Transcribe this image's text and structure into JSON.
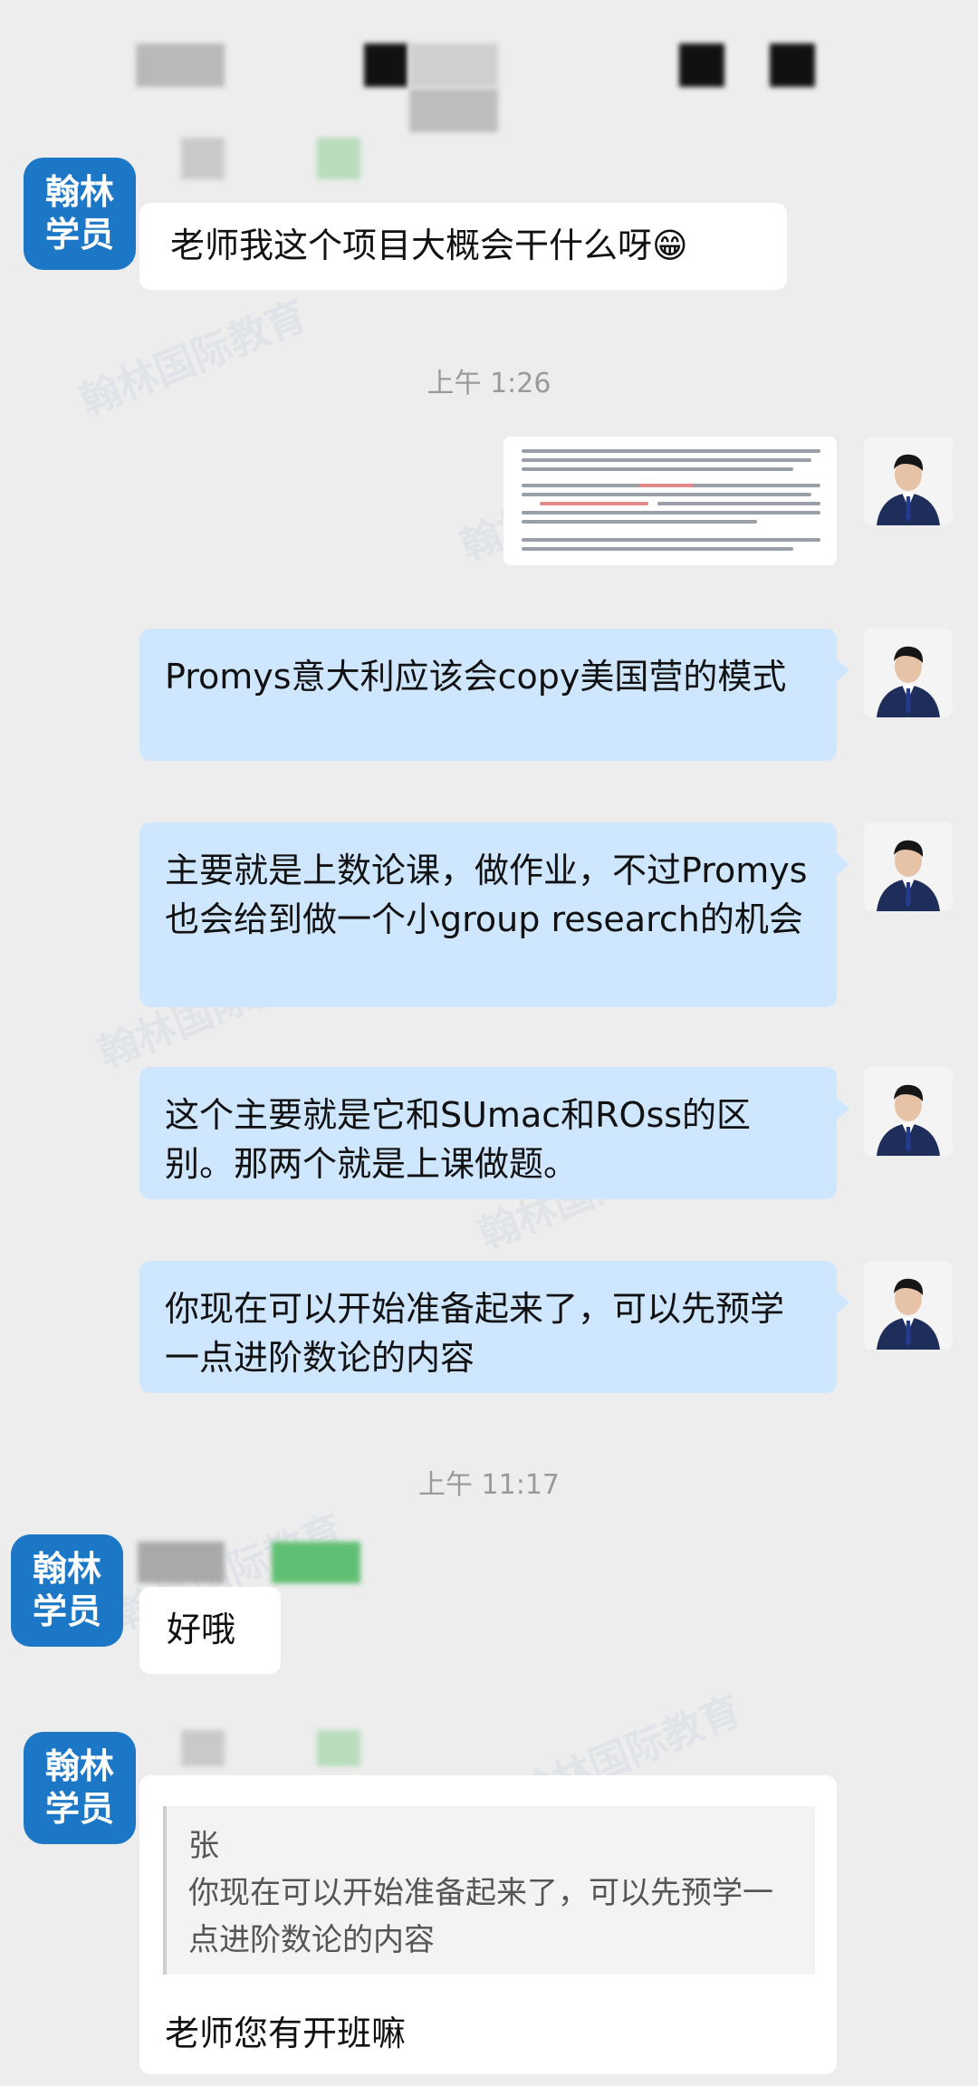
{
  "messages": {
    "student_badge": [
      "翰林",
      "学员"
    ],
    "m1": "老师我这个项目大概会干什么呀😁",
    "ts1": "上午 1:26",
    "m2": "Promys意大利应该会copy美国营的模式",
    "m3": "主要就是上数论课，做作业，不过Promys也会给到做一个小group research的机会",
    "m4": "这个主要就是它和SUmac和ROss的区别。那两个就是上课做题。",
    "m5": "你现在可以开始准备起来了，可以先预学一点进阶数论的内容",
    "ts2": "上午 11:17",
    "m6": "好哦",
    "quote_sender": "张",
    "quote_text": "你现在可以开始准备起来了，可以先预学一点进阶数论的内容",
    "m7": "老师您有开班嘛"
  },
  "colors": {
    "background": "#ededed",
    "student_bubble": "#ffffff",
    "teacher_bubble": "#cfe6ff",
    "badge": "#1c78c6"
  }
}
